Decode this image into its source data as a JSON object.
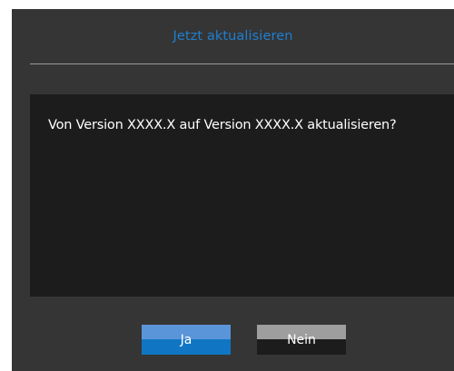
{
  "dialog": {
    "title": "Jetzt aktualisieren",
    "message": "Von Version XXXX.X auf Version XXXX.X aktualisieren?",
    "buttons": {
      "yes_label": "Ja",
      "no_label": "Nein"
    }
  },
  "colors": {
    "dialog_background": "#353535",
    "panel_background": "#1c1c1c",
    "title_accent": "#1f7fd0",
    "yes_button": "#1076c4",
    "no_button": "#9e9e9e"
  }
}
